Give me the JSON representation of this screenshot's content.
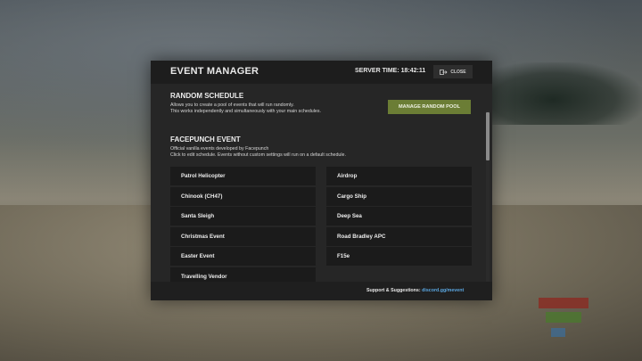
{
  "header": {
    "title": "EVENT MANAGER",
    "server_time_label": "SERVER TIME:",
    "server_time_value": "18:42:11",
    "close_label": "CLOSE"
  },
  "random_schedule": {
    "title": "RANDOM SCHEDULE",
    "desc_line1": "Allows you to create a pool of events that will run randomly.",
    "desc_line2": "This works independently and simultaneously with your main schedules.",
    "button_label": "MANAGE RANDOM POOL"
  },
  "facepunch_event": {
    "title": "FACEPUNCH EVENT",
    "desc_line1": "Official vanilla events developed by Facepunch",
    "desc_line2": "Click to edit schedule. Events without custom settings will run on a default schedule.",
    "events_left": [
      "Patrol Helicopter",
      "Chinook (CH47)",
      "Santa Sleigh",
      "Christmas Event",
      "Easter Event",
      "Travelling Vendor"
    ],
    "events_right": [
      "Airdrop",
      "Cargo Ship",
      "Deep Sea",
      "Road Bradley APC",
      "F15e"
    ]
  },
  "footer": {
    "support_label": "Support & Suggestions:",
    "link": "discord.gg/mevent"
  },
  "icons": {
    "close": "exit-door-icon"
  },
  "colors": {
    "accent_button": "#6b7d35",
    "link": "#5aa6e0",
    "panel": "#262626",
    "event_button": "#1b1b1b"
  }
}
